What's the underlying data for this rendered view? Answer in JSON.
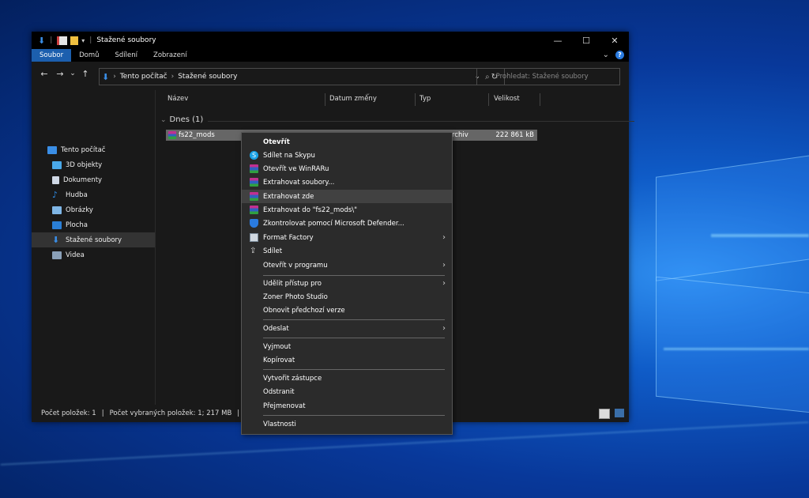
{
  "window": {
    "title": "Stažené soubory",
    "controls": {
      "minimize": "—",
      "maximize": "☐",
      "close": "✕"
    }
  },
  "ribbon": {
    "tabs": [
      "Soubor",
      "Domů",
      "Sdílení",
      "Zobrazení"
    ],
    "expand": "⌄",
    "help": "?"
  },
  "nav": {
    "back": "←",
    "forward": "→",
    "recent": "⌄",
    "up": "↑",
    "path": [
      "Tento počítač",
      "Stažené soubory"
    ],
    "path_sep": "›",
    "refresh": "↻",
    "dropdown": "⌄",
    "search_placeholder": "Prohledat: Stažené soubory",
    "search_icon": "⌕"
  },
  "sidebar": {
    "items": [
      {
        "label": "Tento počítač",
        "icon": "computer-icon",
        "color": "#3a8ee6"
      },
      {
        "label": "3D objekty",
        "icon": "3d-objects-icon",
        "color": "#4aa8e8"
      },
      {
        "label": "Dokumenty",
        "icon": "documents-icon",
        "color": "#cfd8e6"
      },
      {
        "label": "Hudba",
        "icon": "music-icon",
        "color": "#2f8be6"
      },
      {
        "label": "Obrázky",
        "icon": "pictures-icon",
        "color": "#7fb6e6"
      },
      {
        "label": "Plocha",
        "icon": "desktop-icon",
        "color": "#2a7fd6"
      },
      {
        "label": "Stažené soubory",
        "icon": "downloads-icon",
        "color": "#3a8ee6",
        "selected": true
      },
      {
        "label": "Videa",
        "icon": "videos-icon",
        "color": "#8aa0b8"
      }
    ]
  },
  "columns": [
    "Název",
    "Datum změny",
    "Typ",
    "Velikost"
  ],
  "group": {
    "label": "Dnes (1)",
    "chevron": "⌄"
  },
  "file": {
    "name": "fs22_mods",
    "type": "rchiv",
    "size": "222 861 kB"
  },
  "status": {
    "count": "Počet položek: 1",
    "selected": "Počet vybraných položek: 1; 217 MB"
  },
  "context_menu": {
    "submenu_arrow": "›",
    "items": [
      {
        "label": "Otevřít",
        "bold": true
      },
      {
        "label": "Sdílet na Skypu",
        "icon": "skype-icon"
      },
      {
        "label": "Otevřít ve WinRARu",
        "icon": "winrar-icon"
      },
      {
        "label": "Extrahovat soubory...",
        "icon": "winrar-icon"
      },
      {
        "label": "Extrahovat zde",
        "icon": "winrar-icon",
        "highlight": true
      },
      {
        "label": "Extrahovat do \"fs22_mods\\\"",
        "icon": "winrar-icon"
      },
      {
        "label": "Zkontrolovat pomocí Microsoft Defender...",
        "icon": "defender-icon"
      },
      {
        "label": "Format Factory",
        "icon": "format-factory-icon",
        "submenu": true
      },
      {
        "label": "Sdílet",
        "icon": "share-icon"
      },
      {
        "label": "Otevřít v programu",
        "submenu": true
      },
      {
        "label": "Udělit přístup pro",
        "submenu": true
      },
      {
        "label": "Zoner Photo Studio"
      },
      {
        "label": "Obnovit předchozí verze"
      },
      {
        "label": "Odeslat",
        "submenu": true
      },
      {
        "label": "Vyjmout"
      },
      {
        "label": "Kopírovat"
      },
      {
        "label": "Vytvořit zástupce"
      },
      {
        "label": "Odstranit"
      },
      {
        "label": "Přejmenovat"
      },
      {
        "label": "Vlastnosti"
      }
    ]
  }
}
